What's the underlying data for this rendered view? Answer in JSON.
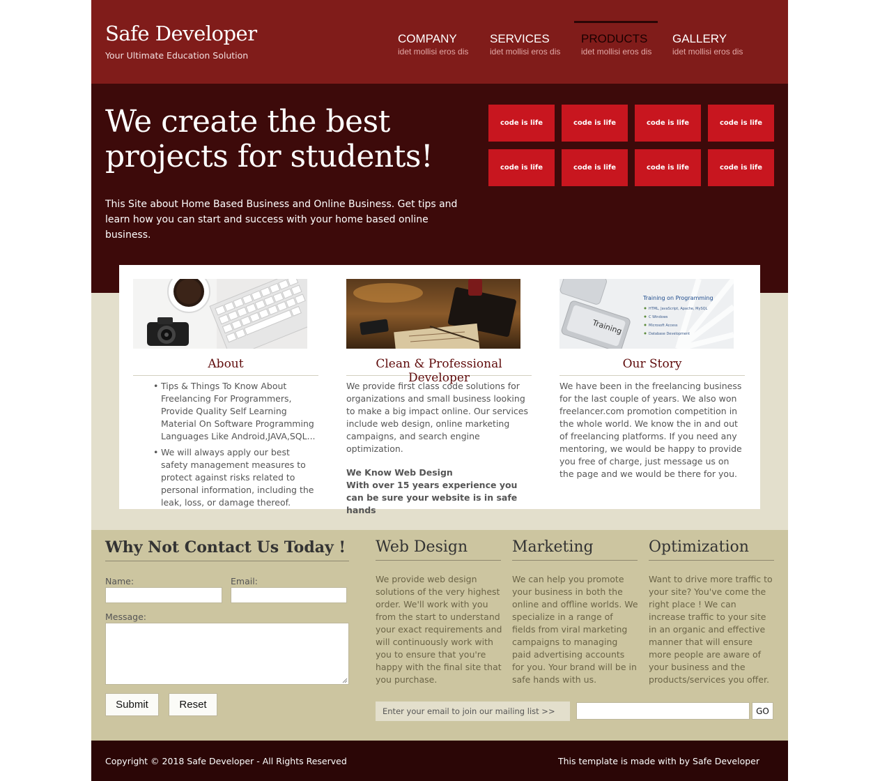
{
  "header": {
    "logo": "Safe Developer",
    "tagline": "Your Ultimate Education Solution",
    "nav": [
      {
        "label": "COMPANY",
        "sub": "idet mollisi eros dis"
      },
      {
        "label": "SERVICES",
        "sub": "idet mollisi eros dis"
      },
      {
        "label": "PRODUCTS",
        "sub": "idet mollisi eros dis",
        "active": true
      },
      {
        "label": "GALLERY",
        "sub": "idet mollisi eros dis"
      }
    ]
  },
  "hero": {
    "title_line1": "We create the best",
    "title_line2": "projects for students!",
    "text": "This Site about Home Based Business and Online Business. Get tips and learn how you can start and success with your home based online business.",
    "tiles": [
      "code is life",
      "code is life",
      "code is life",
      "code is life",
      "code is life",
      "code is life",
      "code is life",
      "code is life"
    ]
  },
  "columns": {
    "about": {
      "title": "About",
      "bullets": [
        "Tips & Things To Know About Freelancing For Programmers, Provide Quality Self Learning Material On Software Programming Languages Like Android,JAVA,SQL...",
        "We will always apply our best safety management measures to protect against risks related to personal information, including the leak, loss, or damage thereof."
      ]
    },
    "developer": {
      "title": "Clean & Professional Developer",
      "text": "We provide first class code solutions for organizations and small business looking to make a big impact online. Our services include web design, online marketing campaigns, and search engine optimization.",
      "strong1": "We Know Web Design",
      "strong2": "With over 15 years experience you can be sure your website is in safe hands"
    },
    "story": {
      "title": "Our Story",
      "text": "We have been in the freelancing business for the last couple of years. We also won freelancer.com promotion competition in the whole world. We know the in and out of freelancing platforms. If you need any mentoring, we would be happy to provide you free of charge, just message us on the page and we would be there for you.",
      "image_heading": "Training on Programming",
      "image_items": [
        "HTML, JavaScript, Apache, MySQL",
        "C Windows",
        "Microsoft Access",
        "Database Development"
      ],
      "key_label": "Training"
    }
  },
  "contact": {
    "title": "Why Not Contact Us Today !",
    "name_label": "Name:",
    "email_label": "Email:",
    "message_label": "Message:",
    "submit": "Submit",
    "reset": "Reset"
  },
  "services": [
    {
      "title": "Web Design",
      "text": "We provide web design solutions of the very highest order. We'll work with you from the start to understand your exact requirements and will continuously work with you to ensure that you're happy with the final site that you purchase."
    },
    {
      "title": "Marketing",
      "text": "We can help you promote your business in both the online and offline worlds. We specialize in a range of fields from viral marketing campaigns to managing paid advertising accounts for you. Your brand will be in safe hands with us."
    },
    {
      "title": "Optimization",
      "text": "Want to drive more traffic to your site? You've come the right place ! We can increase traffic to your site in an organic and effective manner that will ensure more people are aware of your business and the products/services you offer."
    }
  ],
  "mailing": {
    "prompt": "Enter your email to join our mailing list >>",
    "go": "GO"
  },
  "footer": {
    "copyright": "Copyright © 2018 Safe Developer - All Rights Reserved",
    "credit": "This template is made with by Safe Developer"
  },
  "colors": {
    "header_bg": "#801c1a",
    "hero_bg": "#3d0a0a",
    "tile": "#c8161f",
    "band": "#e3dfcc",
    "contact_bg": "#ccc5a0",
    "footer_bg": "#2b0606"
  }
}
